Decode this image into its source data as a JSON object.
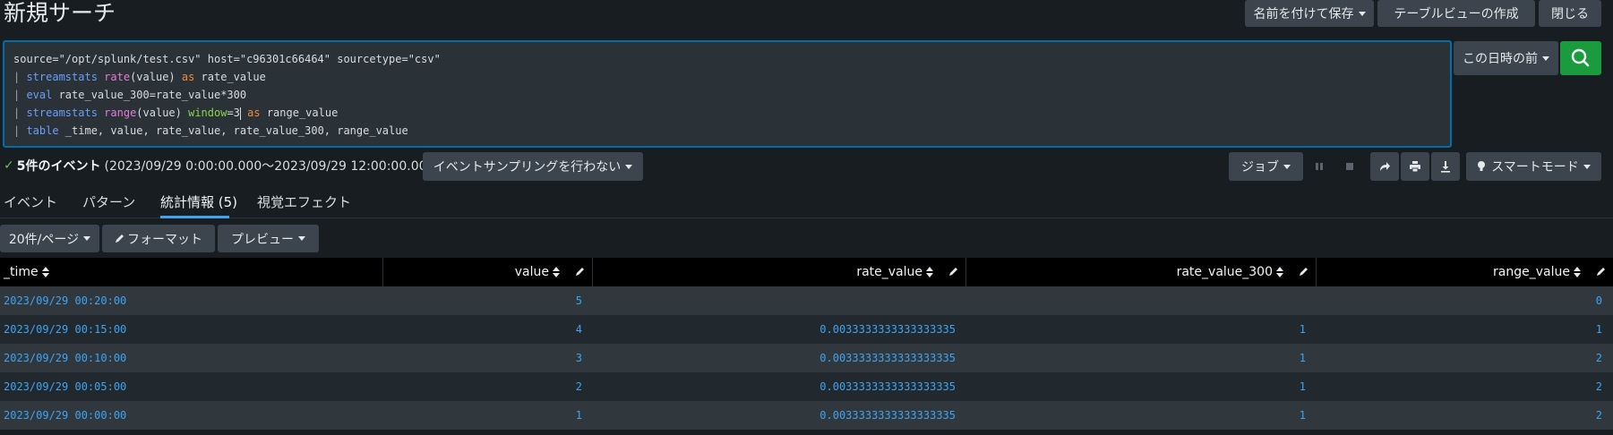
{
  "page": {
    "title": "新規サーチ"
  },
  "header_buttons": {
    "save_as": "名前を付けて保存",
    "create_table_view": "テーブルビューの作成",
    "close": "閉じる"
  },
  "search": {
    "lines": [
      [
        {
          "t": "source=\"/opt/splunk/test.csv\" host=\"c96301c66464\" sourcetype=\"csv\"",
          "c": "plain"
        }
      ],
      [
        {
          "t": "| ",
          "c": "pipe"
        },
        {
          "t": "streamstats",
          "c": "kw"
        },
        {
          "t": " ",
          "c": "plain"
        },
        {
          "t": "rate",
          "c": "fn"
        },
        {
          "t": "(value) ",
          "c": "plain"
        },
        {
          "t": "as",
          "c": "as"
        },
        {
          "t": " rate_value",
          "c": "plain"
        }
      ],
      [
        {
          "t": "| ",
          "c": "pipe"
        },
        {
          "t": "eval",
          "c": "kw"
        },
        {
          "t": " rate_value_300=rate_value*300",
          "c": "plain"
        }
      ],
      [
        {
          "t": "| ",
          "c": "pipe"
        },
        {
          "t": "streamstats",
          "c": "kw"
        },
        {
          "t": " ",
          "c": "plain"
        },
        {
          "t": "range",
          "c": "fn"
        },
        {
          "t": "(value) ",
          "c": "plain"
        },
        {
          "t": "window",
          "c": "arg"
        },
        {
          "t": "=3",
          "c": "plain"
        },
        {
          "t": "|",
          "c": "cursor"
        },
        {
          "t": " ",
          "c": "plain"
        },
        {
          "t": "as",
          "c": "as"
        },
        {
          "t": " range_value",
          "c": "plain"
        }
      ],
      [
        {
          "t": "| ",
          "c": "pipe"
        },
        {
          "t": "table",
          "c": "kw"
        },
        {
          "t": " _time, value, rate_value, rate_value_300, range_value",
          "c": "plain"
        }
      ]
    ],
    "time_range_label": "この日時の前"
  },
  "status": {
    "count_label": "5件のイベント",
    "range_text": "(2023/09/29 0:00:00.000〜2023/09/29 12:00:00.000)",
    "sampling_label": "イベントサンプリングを行わない"
  },
  "job": {
    "job_label": "ジョブ",
    "smart_mode_label": "スマートモード"
  },
  "tabs": [
    {
      "label": "イベント"
    },
    {
      "label": "パターン"
    },
    {
      "label": "統計情報 (5)"
    },
    {
      "label": "視覚エフェクト"
    }
  ],
  "toolbar": {
    "per_page": "20件/ページ",
    "format": "フォーマット",
    "preview": "プレビュー"
  },
  "table": {
    "columns": [
      "_time",
      "value",
      "rate_value",
      "rate_value_300",
      "range_value"
    ],
    "rows": [
      [
        "2023/09/29 00:20:00",
        "5",
        "",
        "",
        "0"
      ],
      [
        "2023/09/29 00:15:00",
        "4",
        "0.0033333333333333335",
        "1",
        "1"
      ],
      [
        "2023/09/29 00:10:00",
        "3",
        "0.0033333333333333335",
        "1",
        "2"
      ],
      [
        "2023/09/29 00:05:00",
        "2",
        "0.0033333333333333335",
        "1",
        "2"
      ],
      [
        "2023/09/29 00:00:00",
        "1",
        "0.0033333333333333335",
        "1",
        "2"
      ]
    ]
  },
  "colors": {
    "accent_blue": "#3fa3f0",
    "search_green": "#1a9c3e",
    "editor_border": "#006eaa"
  }
}
